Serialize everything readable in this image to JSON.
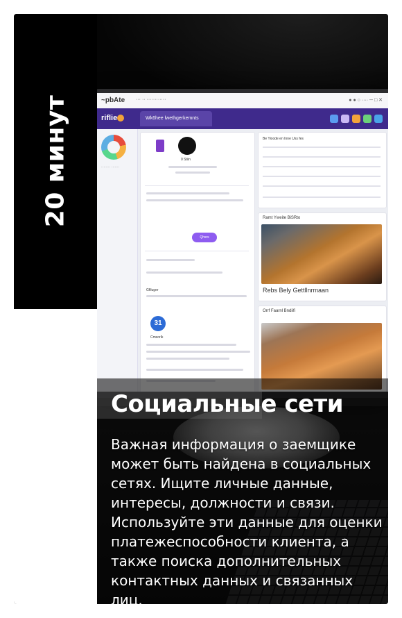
{
  "side_label": "20 минут",
  "title": "Социальные сети",
  "body": "Важная информация о заемщике может быть найдена в социальных сетях. Ищите личные данные, интересы, должности и связи. Используйте эти данные для оценки платежеспособности клиента, а также поиска дополнительных контактных данных и связанных лиц.",
  "photo": {
    "browser_title": "~pbAte",
    "app_logo": "riflie",
    "app_tab": "Wk6hee lwethgerkemnts",
    "feed_button": "Qhsrs",
    "feed_badge": "31",
    "feed_section": "Gfiluger",
    "feed_subsection": "Cmsorlk",
    "stat_title": "Be Yioode en Inne Uss fes",
    "image_card_title": "Ramt Yweite BiSRto",
    "image_card_caption": "Rebs Bely Gettllnrmaan",
    "image_card2_title": "Orrf Faarnl Bndiifi",
    "profile_name": "0 Stiin",
    "header_colors": [
      "#5b9cf0",
      "#c9b8f5",
      "#f2a33a",
      "#6bd17a",
      "#4aa3e8"
    ]
  }
}
